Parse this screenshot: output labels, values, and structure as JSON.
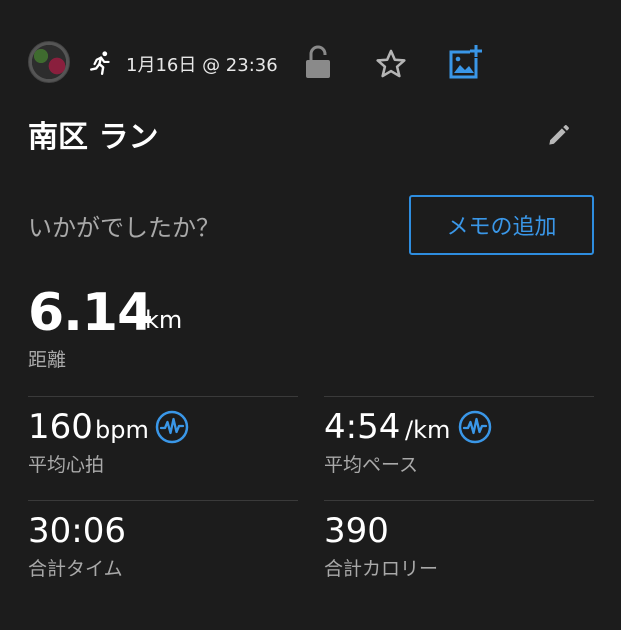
{
  "header": {
    "datetime": "1月16日 @ 23:36"
  },
  "activity": {
    "title": "南区 ラン",
    "question": "いかがでしたか？",
    "memo_button": "メモの追加"
  },
  "distance": {
    "value": "6.14",
    "unit": "km",
    "label": "距離"
  },
  "stats": {
    "heart_rate": {
      "value": "160",
      "unit": "bpm",
      "label": "平均心拍"
    },
    "pace": {
      "value": "4:54",
      "unit": "/km",
      "label": "平均ペース"
    },
    "time": {
      "value": "30:06",
      "label": "合計タイム"
    },
    "calories": {
      "value": "390",
      "label": "合計カロリー"
    }
  },
  "colors": {
    "background": "#1c1c1c",
    "accent": "#2e8ddf",
    "muted_text": "#a9a9a9",
    "divider": "#3a3a3a"
  },
  "icons": [
    "avatar",
    "running-icon",
    "unlock-icon",
    "star-icon",
    "add-photo-icon",
    "pencil-icon",
    "heart-rate-wave-icon",
    "pace-wave-icon"
  ]
}
